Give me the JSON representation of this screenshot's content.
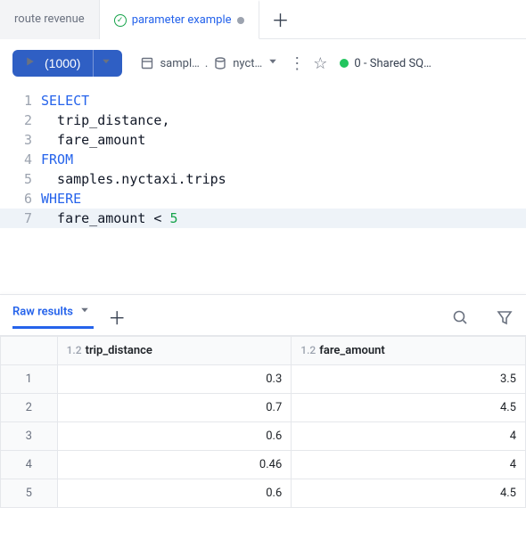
{
  "tabs": {
    "items": [
      {
        "label": "route revenue",
        "active": false,
        "dirty": false,
        "status": null
      },
      {
        "label": "parameter example",
        "active": true,
        "dirty": true,
        "status": "success"
      }
    ]
  },
  "toolbar": {
    "run_label": "(1000)",
    "catalog_label": "sampl…",
    "schema_label": "nyct…",
    "compute_label": "0 - Shared SQ…"
  },
  "editor": {
    "lines": [
      {
        "n": "1",
        "kw": "SELECT",
        "rest": ""
      },
      {
        "n": "2",
        "kw": "",
        "rest": "  trip_distance,"
      },
      {
        "n": "3",
        "kw": "",
        "rest": "  fare_amount"
      },
      {
        "n": "4",
        "kw": "FROM",
        "rest": ""
      },
      {
        "n": "5",
        "kw": "",
        "rest": "  samples.nyctaxi.trips"
      },
      {
        "n": "6",
        "kw": "WHERE",
        "rest": ""
      },
      {
        "n": "7",
        "kw": "",
        "rest": "  fare_amount < ",
        "num": "5",
        "hl": true
      }
    ]
  },
  "results": {
    "tab_label": "Raw results",
    "type_badge": "1.2",
    "columns": [
      "trip_distance",
      "fare_amount"
    ],
    "rows": [
      {
        "n": "1",
        "c0": "0.3",
        "c1": "3.5"
      },
      {
        "n": "2",
        "c0": "0.7",
        "c1": "4.5"
      },
      {
        "n": "3",
        "c0": "0.6",
        "c1": "4"
      },
      {
        "n": "4",
        "c0": "0.46",
        "c1": "4"
      },
      {
        "n": "5",
        "c0": "0.6",
        "c1": "4.5"
      }
    ]
  },
  "chart_data": {
    "type": "table",
    "columns": [
      "trip_distance",
      "fare_amount"
    ],
    "rows": [
      [
        0.3,
        3.5
      ],
      [
        0.7,
        4.5
      ],
      [
        0.6,
        4
      ],
      [
        0.46,
        4
      ],
      [
        0.6,
        4.5
      ]
    ]
  }
}
